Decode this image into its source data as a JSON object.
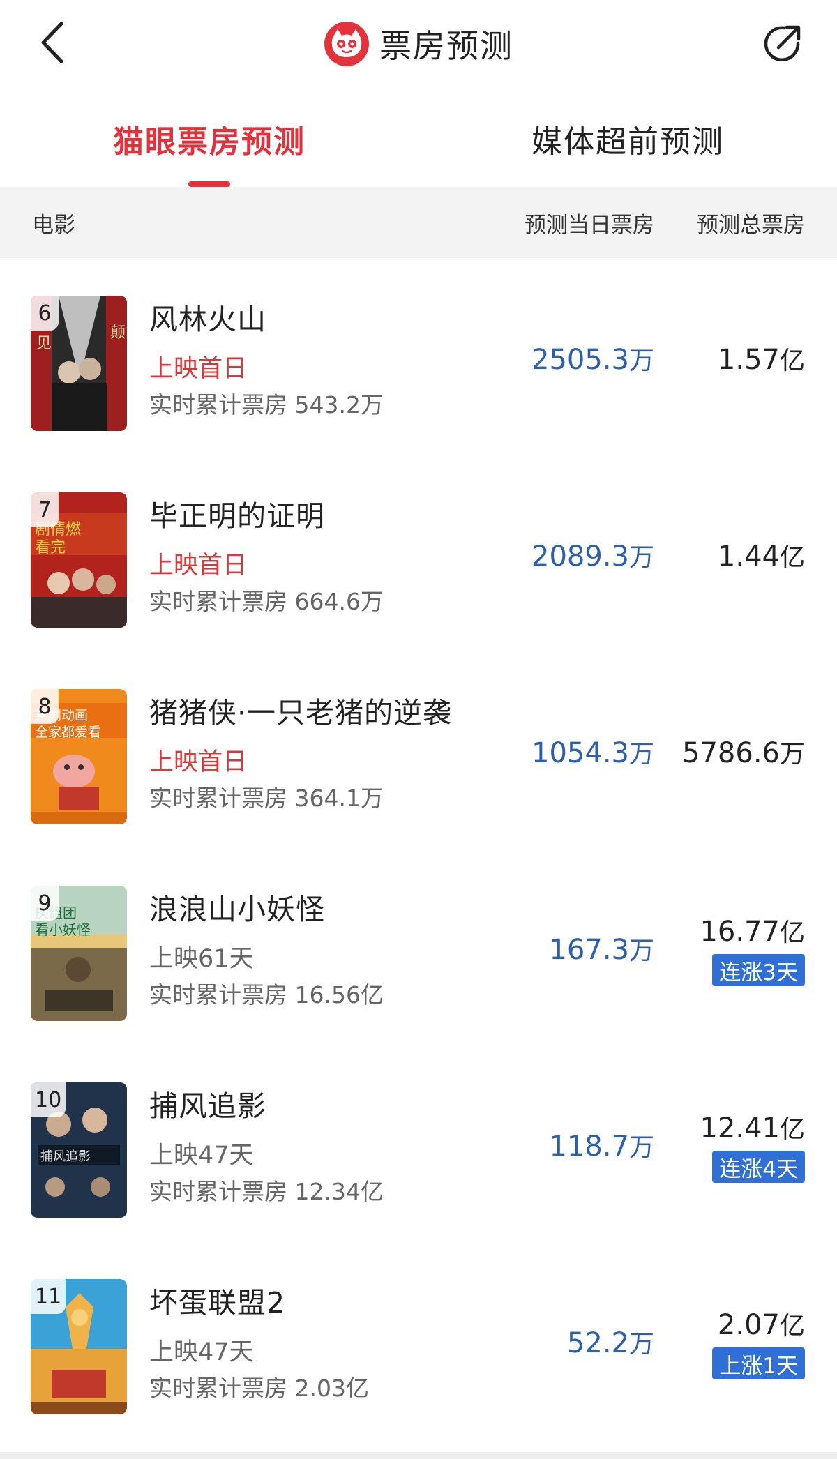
{
  "header": {
    "title": "票房预测"
  },
  "tabs": [
    {
      "label": "猫眼票房预测",
      "active": true
    },
    {
      "label": "媒体超前预测",
      "active": false
    }
  ],
  "columns": {
    "movie": "电影",
    "day": "预测当日票房",
    "total": "预测总票房"
  },
  "colors": {
    "accent": "#e3323c",
    "blue_value": "#2d5fab",
    "badge": "#2f6fd6"
  },
  "movies": [
    {
      "rank": "6",
      "name": "风林火山",
      "status": "上映首日",
      "status_color": "red",
      "cumulative": "实时累计票房 543.2万",
      "day_num": "2505.3",
      "day_unit": "万",
      "total_num": "1.57",
      "total_unit": "亿",
      "badge": ""
    },
    {
      "rank": "7",
      "name": "毕正明的证明",
      "status": "上映首日",
      "status_color": "red",
      "cumulative": "实时累计票房 664.6万",
      "day_num": "2089.3",
      "day_unit": "万",
      "total_num": "1.44",
      "total_unit": "亿",
      "badge": ""
    },
    {
      "rank": "8",
      "name": "猪猪侠·一只老猪的逆袭",
      "status": "上映首日",
      "status_color": "red",
      "cumulative": "实时累计票房 364.1万",
      "day_num": "1054.3",
      "day_unit": "万",
      "total_num": "5786.6",
      "total_unit": "万",
      "badge": ""
    },
    {
      "rank": "9",
      "name": "浪浪山小妖怪",
      "status": "上映61天",
      "status_color": "gray",
      "cumulative": "实时累计票房 16.56亿",
      "day_num": "167.3",
      "day_unit": "万",
      "total_num": "16.77",
      "total_unit": "亿",
      "badge": "连涨3天"
    },
    {
      "rank": "10",
      "name": "捕风追影",
      "status": "上映47天",
      "status_color": "gray",
      "cumulative": "实时累计票房 12.34亿",
      "day_num": "118.7",
      "day_unit": "万",
      "total_num": "12.41",
      "total_unit": "亿",
      "badge": "连涨4天"
    },
    {
      "rank": "11",
      "name": "坏蛋联盟2",
      "status": "上映47天",
      "status_color": "gray",
      "cumulative": "实时累计票房 2.03亿",
      "day_num": "52.2",
      "day_unit": "万",
      "total_num": "2.07",
      "total_unit": "亿",
      "badge": "上涨1天"
    }
  ]
}
